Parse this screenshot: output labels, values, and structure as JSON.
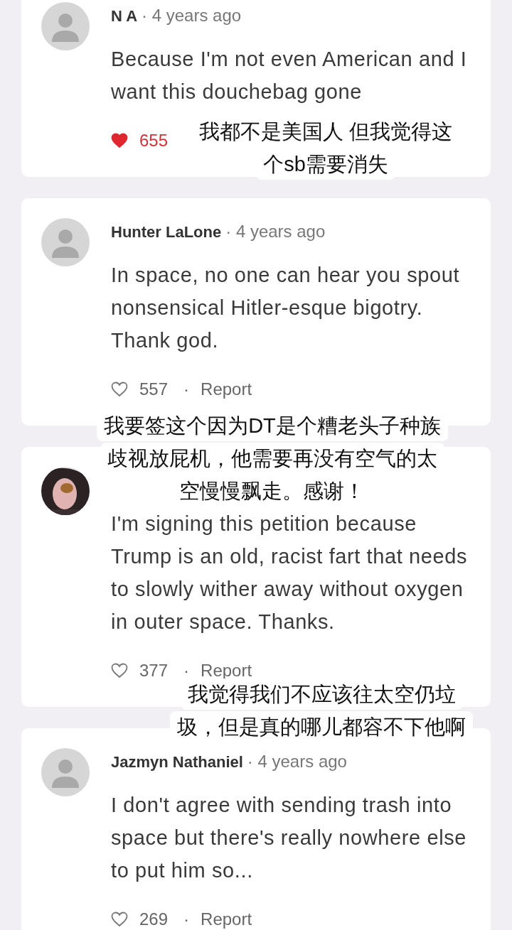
{
  "comments": [
    {
      "avatar": {
        "kind": "placeholder"
      },
      "author": "N A",
      "time": "· 4 years ago",
      "body": "Because I'm not even American and I want this douchebag gone",
      "liked": true,
      "likes": "655"
    },
    {
      "avatar": {
        "kind": "placeholder"
      },
      "author": "Hunter LaLone",
      "time": "· 4 years ago",
      "body": "In space, no one can hear you spout nonsensical Hitler-esque bigotry. Thank god.",
      "liked": false,
      "likes": "557",
      "separator": "·",
      "report": "Report"
    },
    {
      "body": "I'm signing this petition because Trump is an old, racist fart that needs to slowly wither away without oxygen in outer space. Thanks.",
      "liked": false,
      "likes": "377",
      "separator": "·",
      "report": "Report"
    },
    {
      "avatar": {
        "kind": "placeholder"
      },
      "author": "Jazmyn Nathaniel",
      "time": "· 4 years ago",
      "body": "I don't agree with sending trash into space but there's really nowhere else to put him so...",
      "liked": false,
      "likes": "269",
      "separator": "·",
      "report": "Report"
    }
  ],
  "captions": [
    {
      "lines": [
        "我都不是美国人 但我觉得这",
        "个sb需要消失"
      ]
    },
    {
      "lines": [
        "我要签这个因为DT是个糟老头子种族",
        "歧视放屁机，他需要再没有空气的太",
        "空慢慢飘走。感谢！"
      ]
    },
    {
      "lines": [
        "我觉得我们不应该往太空仍垃",
        "圾，但是真的哪儿都容不下他啊"
      ]
    }
  ]
}
